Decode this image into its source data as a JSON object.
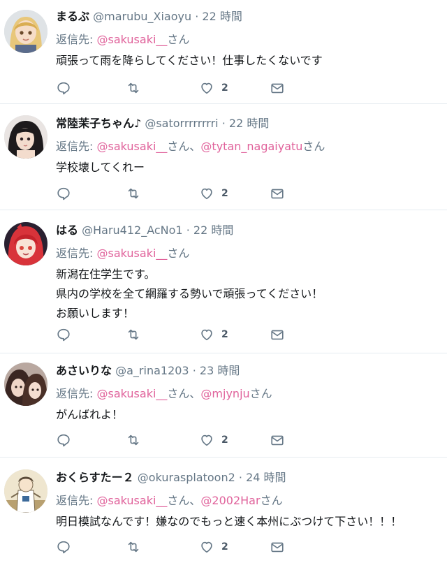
{
  "reply_prefix": "返信先:",
  "suffix_san": "さん",
  "suffix_san_and": "さん、",
  "separator": "·",
  "tweets": [
    {
      "name": "まるぶ",
      "handle": "@marubu_Xiaoyu",
      "time": "22 時間",
      "mentions": [
        "@sakusaki__"
      ],
      "text": [
        "頑張って雨を降らしてください！仕事したくないです"
      ],
      "likes": "2",
      "avatar": "girl-with-blonde-hair"
    },
    {
      "name": "常陸茉子ちゃん♪",
      "handle": "@satorrrrrrrri",
      "time": "22 時間",
      "mentions": [
        "@sakusaki__",
        "@tytan_nagaiyatu"
      ],
      "text": [
        "学校壊してくれー"
      ],
      "likes": "2",
      "avatar": "girl-with-dark-hair"
    },
    {
      "name": "はる",
      "handle": "@Haru412_AcNo1",
      "time": "22 時間",
      "mentions": [
        "@sakusaki__"
      ],
      "text": [
        "新潟在住学生です。",
        "県内の学校を全て網羅する勢いで頑張ってください！",
        "お願いします！"
      ],
      "likes": "2",
      "avatar": "girl-with-red-hair"
    },
    {
      "name": "あさいりな",
      "handle": "@a_rina1203",
      "time": "23 時間",
      "mentions": [
        "@sakusaki__",
        "@mjynju"
      ],
      "text": [
        "がんばれよ！"
      ],
      "likes": "2",
      "avatar": "photo-two-people"
    },
    {
      "name": "おくらすたー２",
      "handle": "@okurasplatoon2",
      "time": "24 時間",
      "mentions": [
        "@sakusaki__",
        "@2002Har"
      ],
      "text": [
        "明日模試なんです！嫌なのでもっと速く本州にぶつけて下さい！！！"
      ],
      "likes": "2",
      "avatar": "character-illustration"
    }
  ]
}
